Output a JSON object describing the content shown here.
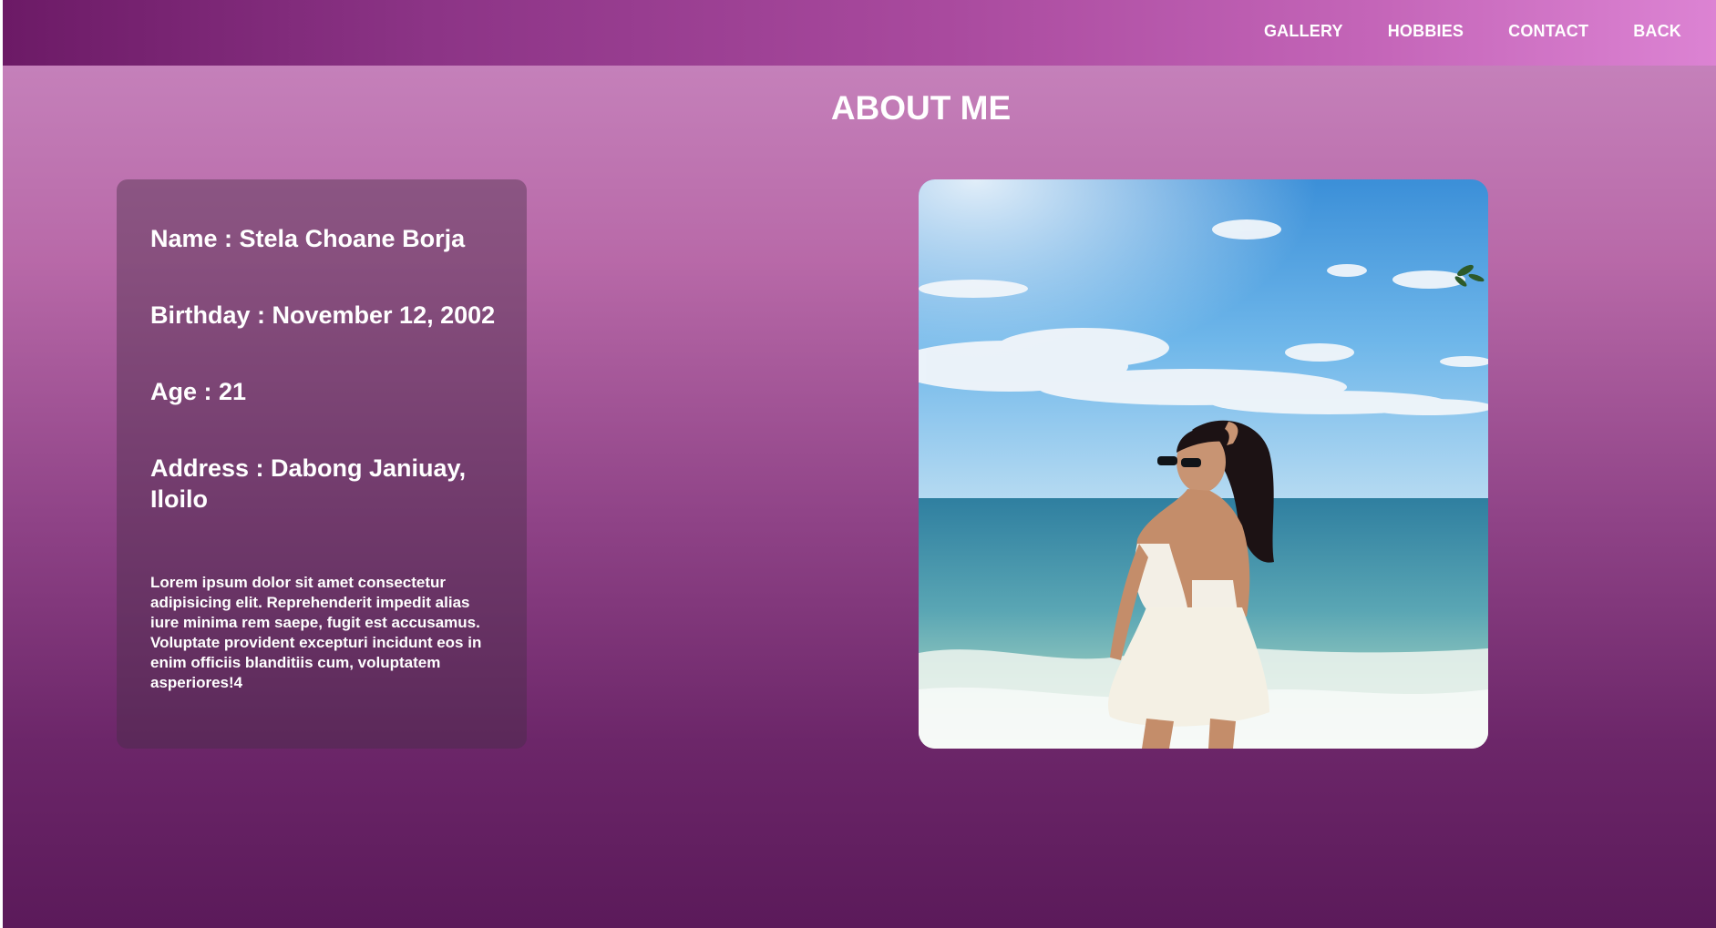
{
  "nav": {
    "items": [
      {
        "label": "GALLERY"
      },
      {
        "label": "HOBBIES"
      },
      {
        "label": "CONTACT"
      },
      {
        "label": "BACK"
      }
    ]
  },
  "main": {
    "title": "ABOUT ME",
    "info": {
      "name": "Name : Stela Choane Borja",
      "birthday": "Birthday : November 12, 2002",
      "age": "Age : 21",
      "address": "Address : Dabong Janiuay, Iloilo",
      "paragraph": "Lorem ipsum dolor sit amet consectetur adipisicing elit. Reprehenderit impedit alias iure minima rem saepe, fugit est accusamus. Voluptate provident excepturi incidunt eos in enim officiis blanditiis cum, voluptatem asperiores!4"
    },
    "photo": {
      "icon": "beach-photo",
      "description_colors": {
        "sky": "#5aaee6",
        "sea": "#3f8fa6",
        "sand": "#e8efe6"
      }
    }
  },
  "colors": {
    "nav_start": "#6c1a66",
    "nav_end": "#dc83d3",
    "page_top": "#c988c0",
    "page_bottom": "#5b1a5a",
    "text": "#ffffff"
  }
}
